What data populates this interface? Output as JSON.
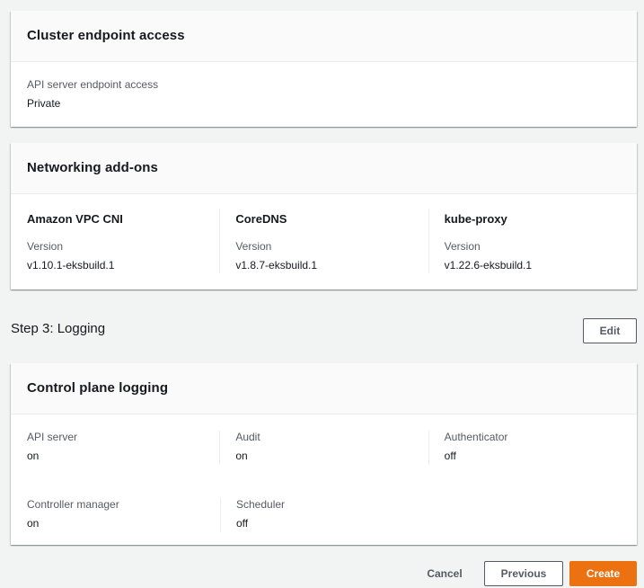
{
  "endpoint_card": {
    "title": "Cluster endpoint access",
    "label": "API server endpoint access",
    "value": "Private"
  },
  "networking_card": {
    "title": "Networking add-ons",
    "version_label": "Version",
    "addons": [
      {
        "name": "Amazon VPC CNI",
        "version": "v1.10.1-eksbuild.1"
      },
      {
        "name": "CoreDNS",
        "version": "v1.8.7-eksbuild.1"
      },
      {
        "name": "kube-proxy",
        "version": "v1.22.6-eksbuild.1"
      }
    ]
  },
  "step3": {
    "title": "Step 3: Logging",
    "edit_label": "Edit"
  },
  "logging_card": {
    "title": "Control plane logging",
    "items": [
      {
        "label": "API server",
        "value": "on"
      },
      {
        "label": "Audit",
        "value": "on"
      },
      {
        "label": "Authenticator",
        "value": "off"
      },
      {
        "label": "Controller manager",
        "value": "on"
      },
      {
        "label": "Scheduler",
        "value": "off"
      }
    ]
  },
  "footer": {
    "cancel_label": "Cancel",
    "previous_label": "Previous",
    "create_label": "Create"
  },
  "colors": {
    "primary": "#ec7211",
    "background": "#f2f3f3"
  }
}
